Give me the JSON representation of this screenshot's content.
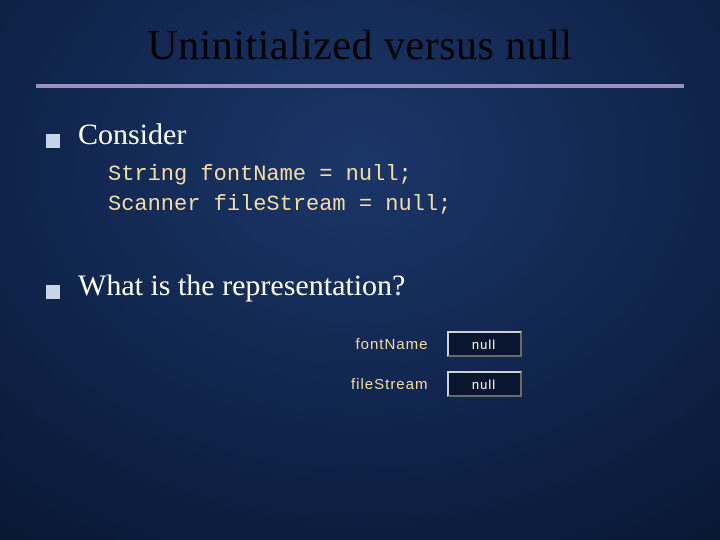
{
  "title": "Uninitialized versus null",
  "bullets": [
    {
      "text": "Consider"
    },
    {
      "text": "What is the representation?"
    }
  ],
  "code": {
    "line1": "String fontName = null;",
    "line2": "Scanner fileStream = null;"
  },
  "diagram": {
    "rows": [
      {
        "label": "fontName",
        "value": "null"
      },
      {
        "label": "fileStream",
        "value": "null"
      }
    ]
  }
}
